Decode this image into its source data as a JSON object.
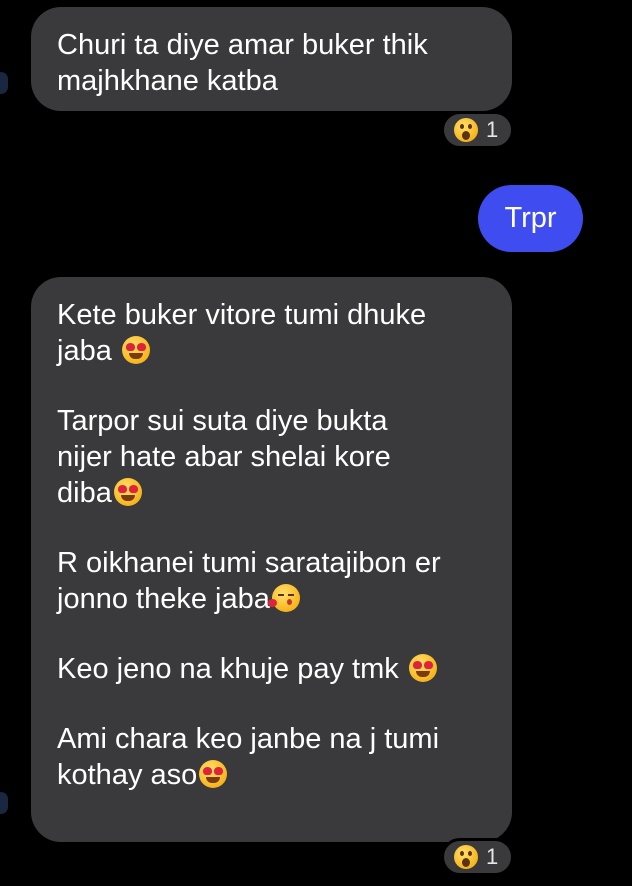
{
  "messages": [
    {
      "id": "incoming-1",
      "direction": "incoming",
      "lines": [
        "Churi  ta diye amar buker thik",
        "majhkhane katba"
      ],
      "reaction": {
        "icon": "wow-emoji-icon",
        "count": "1"
      }
    },
    {
      "id": "outgoing-1",
      "direction": "outgoing",
      "text": "Trpr"
    },
    {
      "id": "incoming-2",
      "direction": "incoming",
      "paragraphs": [
        {
          "lines": [
            "Kete buker vitore tumi dhuke",
            "jaba "
          ],
          "emoji": "heart-eyes-emoji-icon"
        },
        {
          "lines": [
            "Tarpor sui suta diye bukta",
            "nijer hate abar shelai kore",
            "diba"
          ],
          "emoji": "heart-eyes-emoji-icon"
        },
        {
          "lines": [
            "R oikhanei tumi saratajibon er",
            "jonno theke jaba"
          ],
          "emoji": "kiss-emoji-icon"
        },
        {
          "lines": [
            "Keo jeno na khuje pay tmk "
          ],
          "emoji": "heart-eyes-emoji-icon"
        },
        {
          "lines": [
            "Ami chara keo janbe na j tumi",
            "kothay aso"
          ],
          "emoji": "heart-eyes-emoji-icon"
        }
      ],
      "reaction": {
        "icon": "wow-emoji-icon",
        "count": "1"
      }
    }
  ],
  "colors": {
    "background": "#000000",
    "incoming_bubble": "#3a3a3c",
    "outgoing_bubble": "#3f4cf0",
    "text": "#ffffff"
  }
}
